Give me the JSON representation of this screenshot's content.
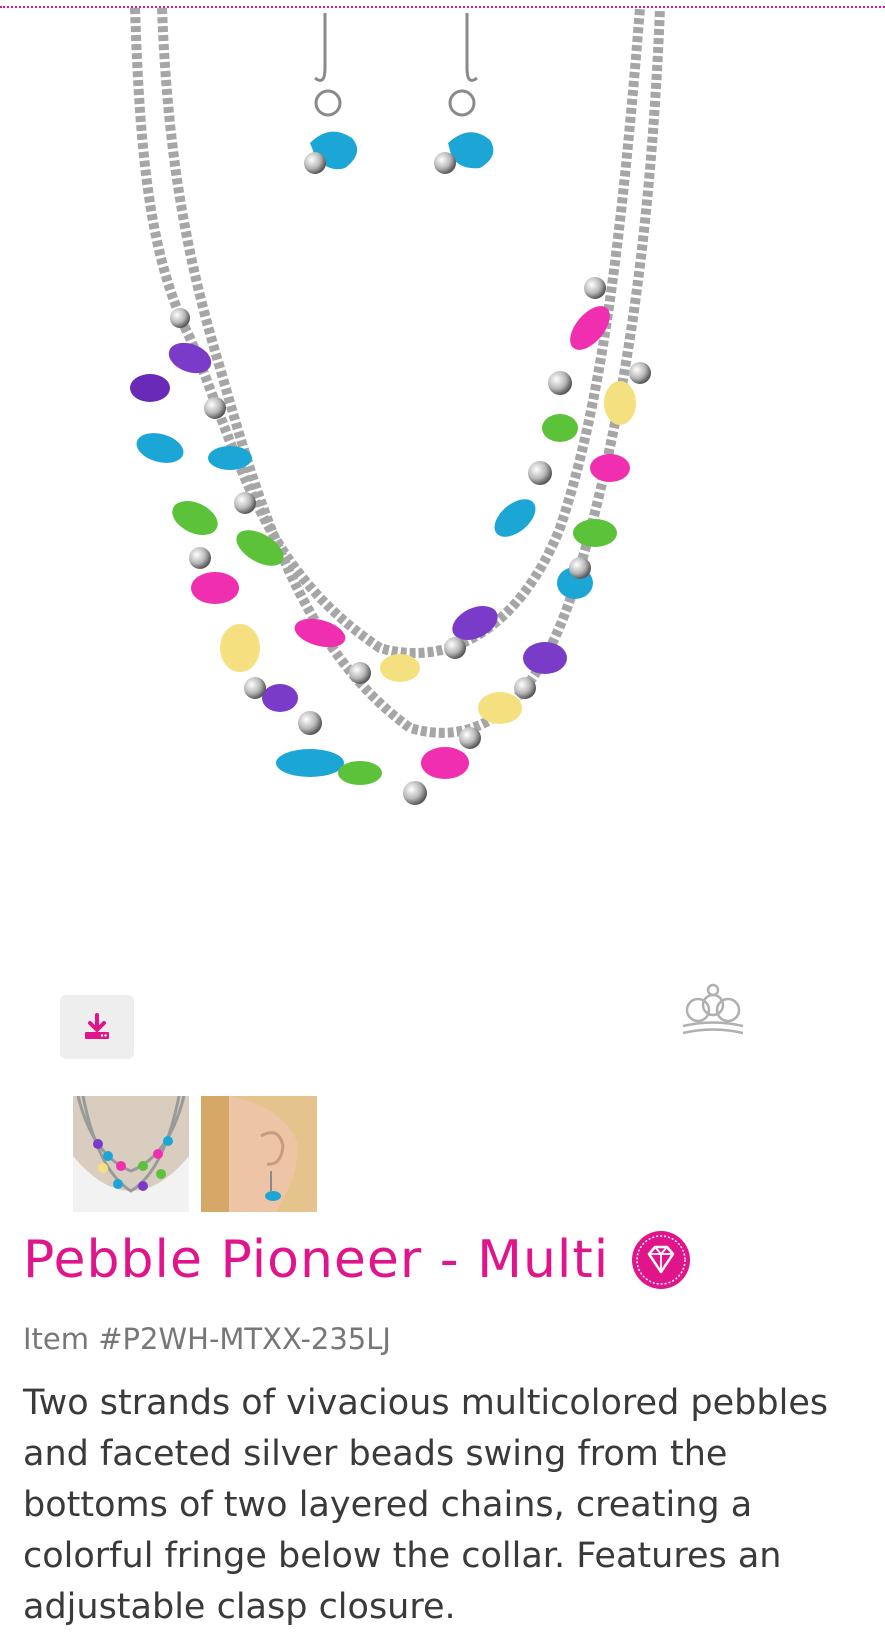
{
  "product": {
    "title": "Pebble Pioneer - Multi",
    "item_number": "Item #P2WH-MTXX-235LJ",
    "description": "Two strands of vivacious multicolored pebbles and faceted silver beads swing from the bottoms of two layered chains, creating a colorful fringe below the collar. Features an adjustable clasp closure."
  },
  "icons": {
    "download": "download-icon",
    "crown": "crown-icon",
    "badge": "diamond-badge-icon"
  },
  "thumbnails": [
    {
      "label": "necklace on model"
    },
    {
      "label": "earring on model"
    }
  ],
  "colors": {
    "brand": "#e0158c",
    "button_bg": "#eeeeee",
    "muted_text": "#777777",
    "body_text": "#3a3a3a"
  }
}
